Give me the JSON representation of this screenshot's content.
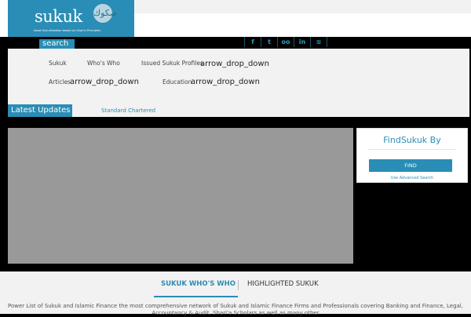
{
  "brand": {
    "name": "sukuk",
    "tagline": "Asset Securitisation based on Shari'a Principles",
    "seal_text": "صكوك",
    "accent_color": "#2a8db5"
  },
  "search_label": "search",
  "social_icons": [
    {
      "name": "facebook-icon",
      "glyph": "f"
    },
    {
      "name": "twitter-icon",
      "glyph": "t"
    },
    {
      "name": "flickr-icon",
      "glyph": "oo"
    },
    {
      "name": "linkedin-icon",
      "glyph": "in"
    },
    {
      "name": "rss-icon",
      "glyph": "≋"
    }
  ],
  "nav": {
    "sukuk": "Sukuk",
    "whos_who": "Who's Who",
    "issued_profiles": "Issued Sukuk Profiles",
    "issued_arrow": "arrow_drop_down",
    "articles": "Articles",
    "articles_arrow": "arrow_drop_down",
    "education": "Education",
    "education_arrow": "arrow_drop_down"
  },
  "updates": {
    "label": "Latest Updates",
    "ticker": "Standard Chartered"
  },
  "find": {
    "title_find": "Find",
    "title_rest": "Sukuk By",
    "button": "FIND",
    "advanced": "Use Advanced Search"
  },
  "bottom": {
    "tab_active": "SUKUK WHO'S WHO",
    "tab_other": "HIGHLIGHTED SUKUK",
    "description": "Power List of Sukuk and Islamic Finance the most comprehensive network of Sukuk and Islamic Finance Firms and Professionals covering Banking and Finance, Legal, Accountancy & Audit, Shari'a Scholars as well as many other"
  }
}
